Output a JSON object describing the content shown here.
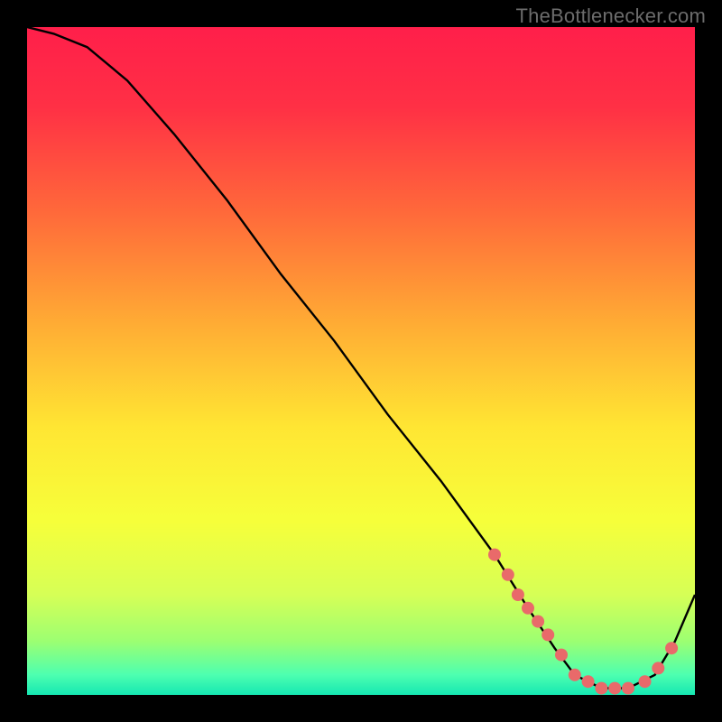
{
  "credit": "TheBottlenecker.com",
  "chart_data": {
    "type": "line",
    "title": "",
    "xlabel": "",
    "ylabel": "",
    "xlim": [
      0,
      100
    ],
    "ylim": [
      0,
      100
    ],
    "grid": false,
    "series": [
      {
        "name": "curve",
        "x": [
          0,
          4,
          9,
          15,
          22,
          30,
          38,
          46,
          54,
          62,
          70,
          75,
          79,
          82,
          86,
          90,
          94,
          97,
          100
        ],
        "y": [
          100,
          99,
          97,
          92,
          84,
          74,
          63,
          53,
          42,
          32,
          21,
          13,
          7,
          3,
          1,
          1,
          3,
          8,
          15
        ]
      }
    ],
    "markers": {
      "name": "dots",
      "color": "#e96a6a",
      "x": [
        70,
        72,
        73.5,
        75,
        76.5,
        78,
        80,
        82,
        84,
        86,
        88,
        90,
        92.5,
        94.5,
        96.5
      ],
      "y": [
        21,
        18,
        15,
        13,
        11,
        9,
        6,
        3,
        2,
        1,
        1,
        1,
        2,
        4,
        7
      ]
    },
    "background_gradient": {
      "stops": [
        {
          "offset": 0.0,
          "color": "#ff1f4a"
        },
        {
          "offset": 0.12,
          "color": "#ff3045"
        },
        {
          "offset": 0.28,
          "color": "#ff6a3a"
        },
        {
          "offset": 0.45,
          "color": "#ffae34"
        },
        {
          "offset": 0.6,
          "color": "#ffe633"
        },
        {
          "offset": 0.74,
          "color": "#f6ff3a"
        },
        {
          "offset": 0.85,
          "color": "#d6ff56"
        },
        {
          "offset": 0.92,
          "color": "#9cff72"
        },
        {
          "offset": 0.97,
          "color": "#4dffb0"
        },
        {
          "offset": 1.0,
          "color": "#15e7b2"
        }
      ]
    }
  }
}
